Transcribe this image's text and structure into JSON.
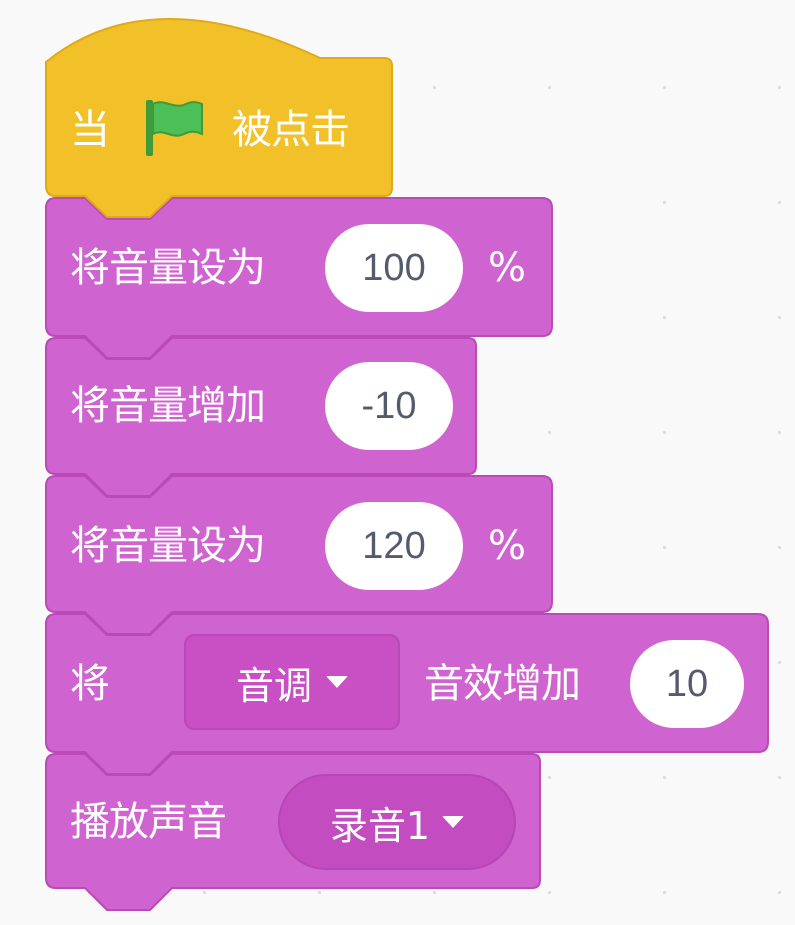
{
  "when_flag_clicked": {
    "prefix": "当",
    "suffix": "被点击",
    "icon": "green-flag-icon"
  },
  "set_volume_1": {
    "label": "将音量设为",
    "value": "100",
    "unit": "%"
  },
  "change_volume": {
    "label": "将音量增加",
    "value": "-10"
  },
  "set_volume_2": {
    "label": "将音量设为",
    "value": "120",
    "unit": "%"
  },
  "change_effect": {
    "prefix": "将",
    "effect": "音调",
    "label": "音效增加",
    "value": "10"
  },
  "play_sound": {
    "label": "播放声音",
    "sound": "录音1"
  },
  "colors": {
    "event": "#f2c12a",
    "sound": "#cf63cf",
    "sound_border": "#b94ab6",
    "field_text": "#555b6e"
  }
}
